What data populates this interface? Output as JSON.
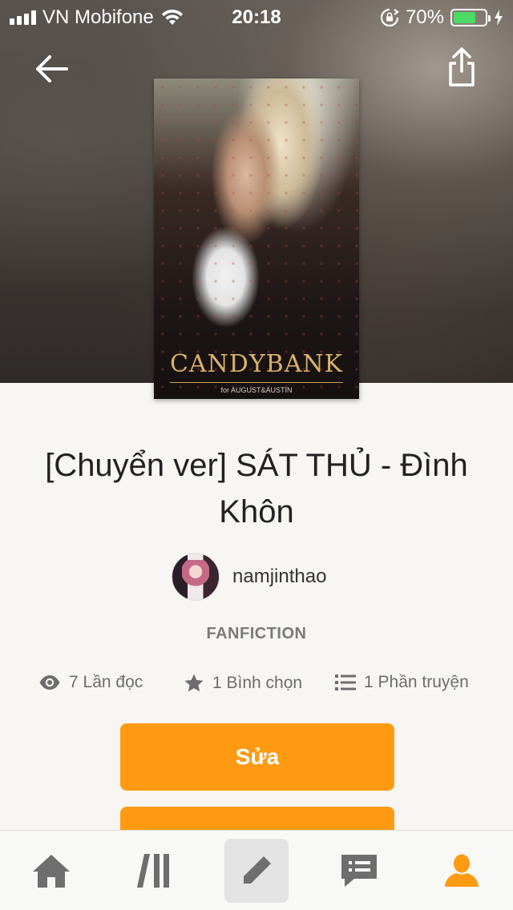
{
  "status_bar": {
    "carrier": "VN Mobifone",
    "time": "20:18",
    "battery_percent": "70%",
    "battery_level": 0.7
  },
  "cover": {
    "title": "CANDYBANK",
    "subtitle": "for AUGUST&AUSTIN"
  },
  "book": {
    "title": "[Chuyển ver] SÁT THỦ - Đình Khôn",
    "author": "namjinthao",
    "genre": "FANFICTION"
  },
  "stats": {
    "reads": "7 Lần đọc",
    "votes": "1 Bình chọn",
    "parts": "1 Phần truyện"
  },
  "actions": {
    "edit_label": "Sửa"
  },
  "tabbar": {
    "items": [
      "home-icon",
      "library-icon",
      "write-icon",
      "messages-icon",
      "profile-icon"
    ],
    "active_index": 4
  },
  "colors": {
    "accent": "#ff9a12",
    "tab_icon": "#6e6e6e",
    "battery": "#4cd964"
  }
}
